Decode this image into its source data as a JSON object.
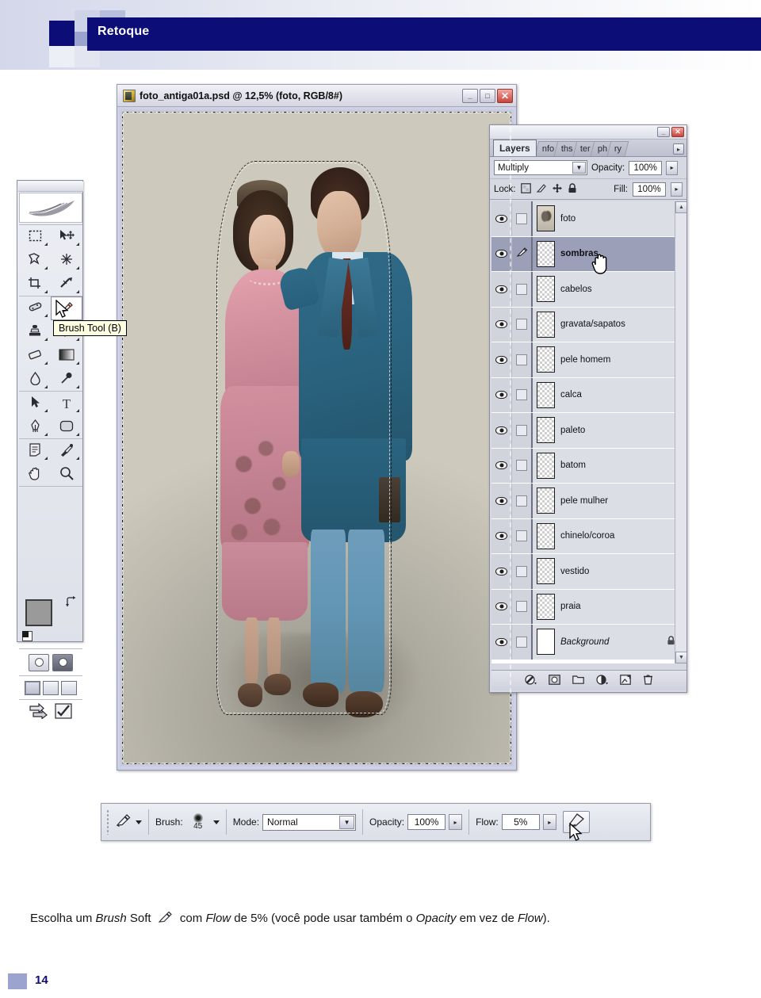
{
  "header": {
    "title": "Retoque",
    "accent_color": "#0d0d77",
    "tile_color": "#9ba3cf"
  },
  "document_window": {
    "icon": "photoshop-document-icon",
    "title": "foto_antiga01a.psd @ 12,5% (foto, RGB/8#)",
    "buttons": {
      "minimize": "_",
      "maximize": "□",
      "close": "✕"
    },
    "image_description": "foto antiga colorizada de um casal com selecao marching ants"
  },
  "toolbox": {
    "name": "photoshop-toolbox",
    "logo": "photoshop-feather-logo",
    "active_tool": "brush-tool",
    "tooltip": "Brush Tool (B)",
    "tools": [
      {
        "name": "marquee-tool",
        "glyph": "⬚"
      },
      {
        "name": "move-tool",
        "glyph": "✛"
      },
      {
        "name": "lasso-tool",
        "glyph": "✠"
      },
      {
        "name": "magic-wand-tool",
        "glyph": "✳"
      },
      {
        "name": "crop-tool",
        "glyph": "⊕"
      },
      {
        "name": "slice-tool",
        "glyph": "✂"
      },
      {
        "name": "healing-brush-tool",
        "glyph": "✒"
      },
      {
        "name": "brush-tool",
        "glyph": "✎"
      },
      {
        "name": "clone-stamp-tool",
        "glyph": "☗"
      },
      {
        "name": "history-brush-tool",
        "glyph": "↙"
      },
      {
        "name": "eraser-tool",
        "glyph": "▱"
      },
      {
        "name": "gradient-tool",
        "glyph": "▤"
      },
      {
        "name": "blur-tool",
        "glyph": "●"
      },
      {
        "name": "dodge-tool",
        "glyph": "◖"
      },
      {
        "name": "path-selection-tool",
        "glyph": "➤"
      },
      {
        "name": "type-tool",
        "glyph": "T"
      },
      {
        "name": "pen-tool",
        "glyph": "✑"
      },
      {
        "name": "shape-tool",
        "glyph": "▢"
      },
      {
        "name": "notes-tool",
        "glyph": "▤"
      },
      {
        "name": "eyedropper-tool",
        "glyph": "⚗"
      },
      {
        "name": "hand-tool",
        "glyph": "✋"
      },
      {
        "name": "zoom-tool",
        "glyph": "⚲"
      }
    ],
    "foreground_color": "#9a9a9a",
    "background_color": "#ffffff",
    "swap_icon": "swap-colors-icon",
    "default_colors_icon": "default-colors-icon",
    "mask_modes": [
      "standard-mask-mode",
      "quick-mask-mode"
    ],
    "screen_modes": [
      "standard-screen-mode",
      "full-screen-menubar-mode",
      "full-screen-mode"
    ],
    "jump_buttons": [
      "jump-to-imageready",
      "edit-in-imageready"
    ]
  },
  "layers_panel": {
    "title_buttons": {
      "minimize": "_",
      "close": "✕"
    },
    "tabs": [
      {
        "label": "Layers",
        "active": true
      },
      {
        "label": "nfo",
        "active": false
      },
      {
        "label": "ths",
        "active": false
      },
      {
        "label": "ter",
        "active": false
      },
      {
        "label": "ph",
        "active": false
      },
      {
        "label": "ry",
        "active": false
      }
    ],
    "menu_button": "▸",
    "blend_mode": "Multiply",
    "opacity_label": "Opacity:",
    "opacity_value": "100%",
    "lock_label": "Lock:",
    "lock_icons": [
      "lock-transparency-icon",
      "lock-image-icon",
      "lock-position-icon",
      "lock-all-icon"
    ],
    "fill_label": "Fill:",
    "fill_value": "100%",
    "layers": [
      {
        "name": "foto",
        "visible": true,
        "selected": false,
        "linked": false,
        "locked": false,
        "thumb": "opaque"
      },
      {
        "name": "sombras",
        "visible": true,
        "selected": true,
        "linked": true,
        "locked": false,
        "thumb": "transparent"
      },
      {
        "name": "cabelos",
        "visible": true,
        "selected": false,
        "linked": false,
        "locked": false,
        "thumb": "transparent"
      },
      {
        "name": "gravata/sapatos",
        "visible": true,
        "selected": false,
        "linked": false,
        "locked": false,
        "thumb": "transparent"
      },
      {
        "name": "pele homem",
        "visible": true,
        "selected": false,
        "linked": false,
        "locked": false,
        "thumb": "transparent"
      },
      {
        "name": "calca",
        "visible": true,
        "selected": false,
        "linked": false,
        "locked": false,
        "thumb": "transparent"
      },
      {
        "name": "paleto",
        "visible": true,
        "selected": false,
        "linked": false,
        "locked": false,
        "thumb": "transparent"
      },
      {
        "name": "batom",
        "visible": true,
        "selected": false,
        "linked": false,
        "locked": false,
        "thumb": "transparent"
      },
      {
        "name": "pele mulher",
        "visible": true,
        "selected": false,
        "linked": false,
        "locked": false,
        "thumb": "transparent"
      },
      {
        "name": "chinelo/coroa",
        "visible": true,
        "selected": false,
        "linked": false,
        "locked": false,
        "thumb": "transparent"
      },
      {
        "name": "vestido",
        "visible": true,
        "selected": false,
        "linked": false,
        "locked": false,
        "thumb": "transparent"
      },
      {
        "name": "praia",
        "visible": true,
        "selected": false,
        "linked": false,
        "locked": false,
        "thumb": "transparent"
      },
      {
        "name": "Background",
        "visible": true,
        "selected": false,
        "linked": false,
        "locked": true,
        "thumb": "opaque"
      }
    ],
    "footer_icons": [
      "layer-style-icon",
      "layer-mask-icon",
      "new-group-icon",
      "adjustment-layer-icon",
      "new-layer-icon",
      "delete-layer-icon"
    ],
    "scrollbar": {
      "up": "▲",
      "down": "▼"
    }
  },
  "options_bar": {
    "tool_preset_icon": "brush-tool-icon",
    "tool_preset_caret": "▾",
    "brush_label": "Brush:",
    "brush_size": "45",
    "brush_caret": "▾",
    "mode_label": "Mode:",
    "mode_value": "Normal",
    "opacity_label": "Opacity:",
    "opacity_value": "100%",
    "flow_label": "Flow:",
    "flow_value": "5%",
    "airbrush_icon": "airbrush-icon"
  },
  "caption": {
    "part1": "Escolha um ",
    "em1": "Brush",
    "part2": " Soft ",
    "part3": " com ",
    "em2": "Flow",
    "part4": " de 5% (você pode usar também o ",
    "em3": "Opacity",
    "part5": " em vez de ",
    "em4": "Flow",
    "part6": ")."
  },
  "footer": {
    "page_number": "14"
  }
}
